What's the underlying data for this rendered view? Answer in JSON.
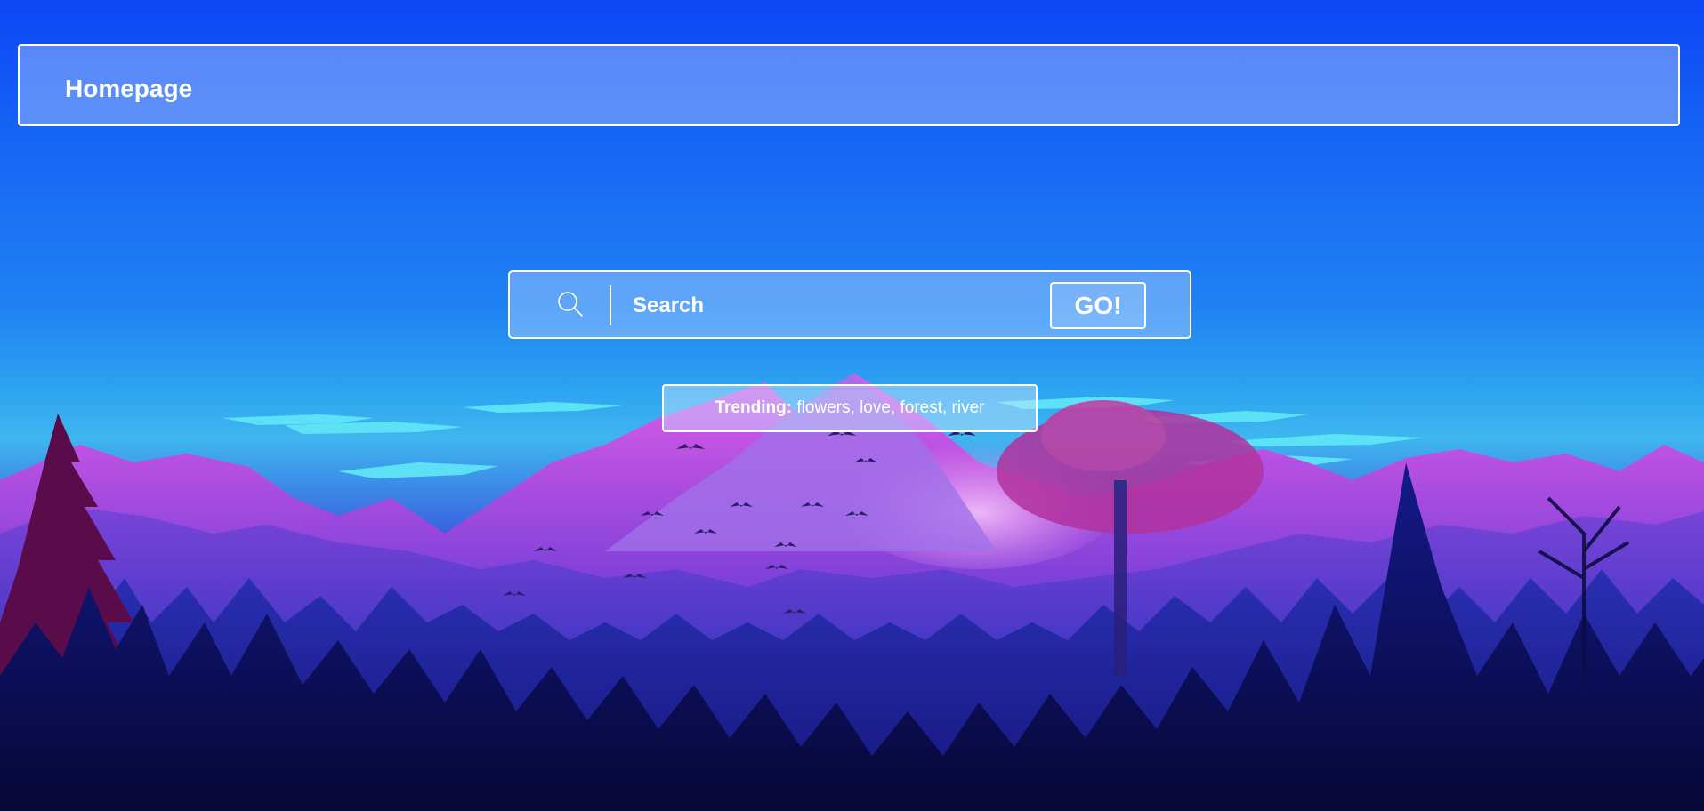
{
  "header": {
    "title": "Homepage"
  },
  "search": {
    "placeholder": "Search",
    "value": "",
    "icon": "search-icon",
    "button_label": "GO!"
  },
  "trending": {
    "label": "Trending:",
    "terms_text": " flowers, love, forest, river"
  },
  "background": {
    "description_colors": {
      "sky_top": "#0c46f5",
      "sky_mid": "#2ea3f0",
      "clouds": "#5fe8f5",
      "mountains": "#c94be0",
      "trees": "#1a1670"
    }
  }
}
